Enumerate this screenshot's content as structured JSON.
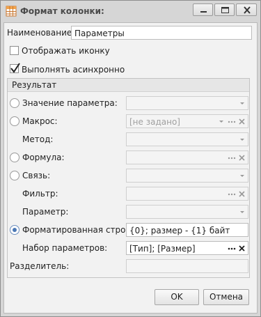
{
  "window": {
    "title": "Формат колонки:",
    "icon": "table-icon",
    "controls": [
      "minimize-icon",
      "maximize-icon",
      "close-icon"
    ]
  },
  "name_field": {
    "label": "Наименование:",
    "value": "Параметры"
  },
  "show_icon": {
    "label": "Отображать иконку",
    "checked": false
  },
  "async_exec": {
    "label": "Выполнять асинхронно",
    "checked": true
  },
  "result_group": {
    "title": "Результат",
    "param_value": {
      "label": "Значение параметра:",
      "value": ""
    },
    "macro": {
      "label": "Макрос:",
      "value": "[не задано]"
    },
    "method": {
      "label": "Метод:",
      "value": ""
    },
    "formula": {
      "label": "Формула:",
      "value": ""
    },
    "link": {
      "label": "Связь:",
      "value": ""
    },
    "filter": {
      "label": "Фильтр:",
      "value": ""
    },
    "parameter": {
      "label": "Параметр:",
      "value": ""
    },
    "formatted_string": {
      "label": "Форматированная строка:",
      "value": "{0}; размер - {1} байт",
      "selected": true
    },
    "param_set": {
      "label": "Набор параметров:",
      "value": "[Тип]; [Размер]"
    },
    "separator": {
      "label": "Разделитель:",
      "value": ""
    }
  },
  "buttons": {
    "ok": "OK",
    "cancel": "Отмена"
  },
  "colors": {
    "accent": "#4b78b5",
    "background": "#f2f2f2",
    "frame": "#d6d6d6"
  }
}
